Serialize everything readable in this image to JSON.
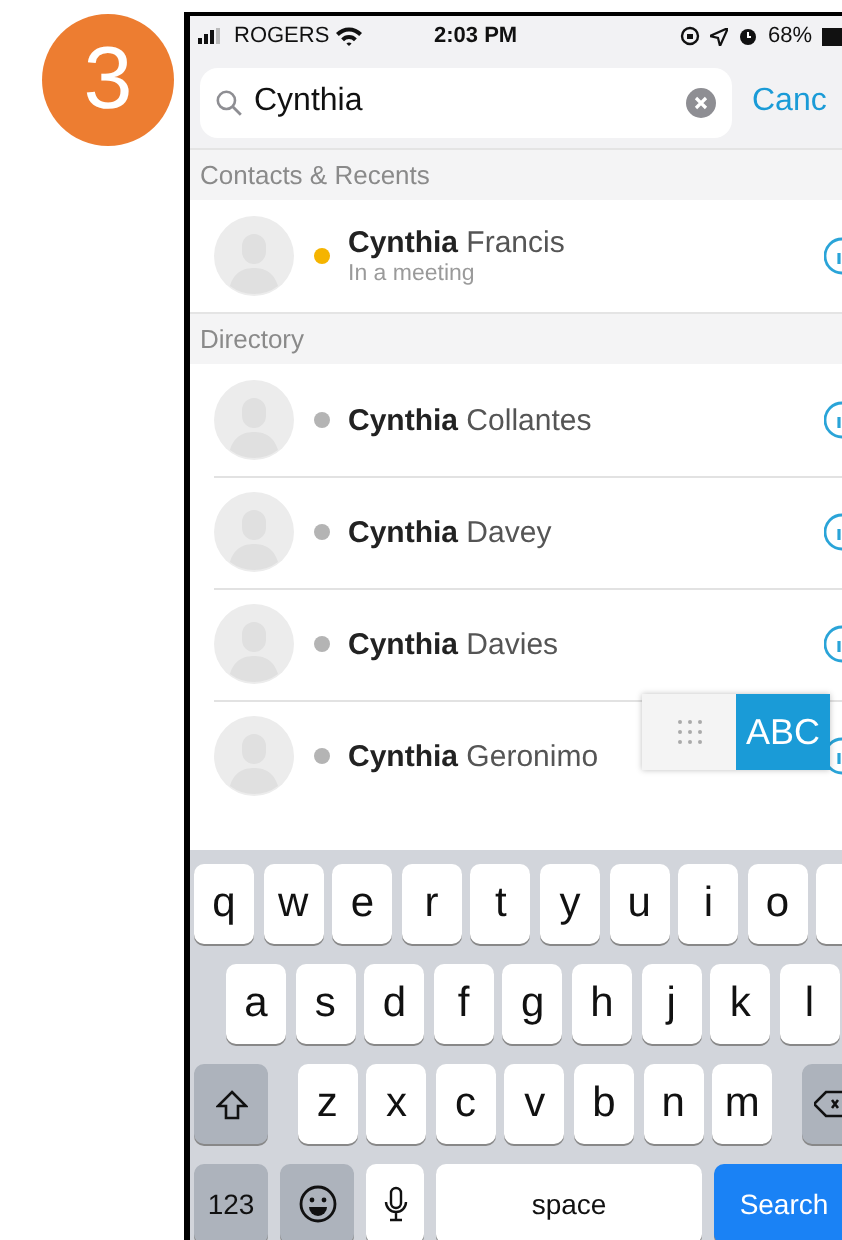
{
  "badge": "3",
  "status_bar": {
    "carrier": "ROGERS",
    "time": "2:03 PM",
    "battery": "68%"
  },
  "search": {
    "value": "Cynthia",
    "cancel": "Canc"
  },
  "sections": [
    {
      "title": "Contacts & Recents",
      "contacts": [
        {
          "name": "**Cynthia** Francis",
          "status": "In a meeting",
          "color": "#f5b400"
        }
      ]
    },
    {
      "title": "Directory",
      "contacts": [
        {
          "name": "**Cynthia** Collantes",
          "color": "#b4b4b4"
        },
        {
          "name": "**Cynthia** Davey",
          "color": "#b4b4b4"
        },
        {
          "name": "**Cynthia** Davies",
          "color": "#b4b4b4"
        },
        {
          "name": "**Cynthia** Geronimo",
          "color": "#b4b4b4"
        }
      ]
    }
  ],
  "mode_toggle": [
    {
      "kind": "dialpad",
      "selected": false
    },
    {
      "kind": "text",
      "label": "ABC",
      "selected": true
    }
  ],
  "keyboard": [
    [
      {
        "kind": "letter",
        "label": "q"
      },
      {
        "kind": "letter",
        "label": "w"
      },
      {
        "kind": "letter",
        "label": "e"
      },
      {
        "kind": "letter",
        "label": "r"
      },
      {
        "kind": "letter",
        "label": "t"
      },
      {
        "kind": "letter",
        "label": "y"
      },
      {
        "kind": "letter",
        "label": "u"
      },
      {
        "kind": "letter",
        "label": "i"
      },
      {
        "kind": "letter",
        "label": "o"
      },
      {
        "kind": "cut"
      }
    ],
    [
      {
        "kind": "letter",
        "label": "a"
      },
      {
        "kind": "letter",
        "label": "s"
      },
      {
        "kind": "letter",
        "label": "d"
      },
      {
        "kind": "letter",
        "label": "f"
      },
      {
        "kind": "letter",
        "label": "g"
      },
      {
        "kind": "letter",
        "label": "h"
      },
      {
        "kind": "letter",
        "label": "j"
      },
      {
        "kind": "letter",
        "label": "k"
      },
      {
        "kind": "letter",
        "label": "l"
      }
    ],
    [
      {
        "kind": "shift"
      },
      {
        "kind": "letter",
        "label": "z"
      },
      {
        "kind": "letter",
        "label": "x"
      },
      {
        "kind": "letter",
        "label": "c"
      },
      {
        "kind": "letter",
        "label": "v"
      },
      {
        "kind": "letter",
        "label": "b"
      },
      {
        "kind": "letter",
        "label": "n"
      },
      {
        "kind": "letter",
        "label": "m"
      },
      {
        "kind": "delete"
      }
    ],
    [
      {
        "kind": "numbers",
        "label": "123"
      },
      {
        "kind": "emoji"
      },
      {
        "kind": "mic"
      },
      {
        "kind": "space",
        "label": "space"
      },
      {
        "kind": "search",
        "label": "Search"
      }
    ]
  ]
}
